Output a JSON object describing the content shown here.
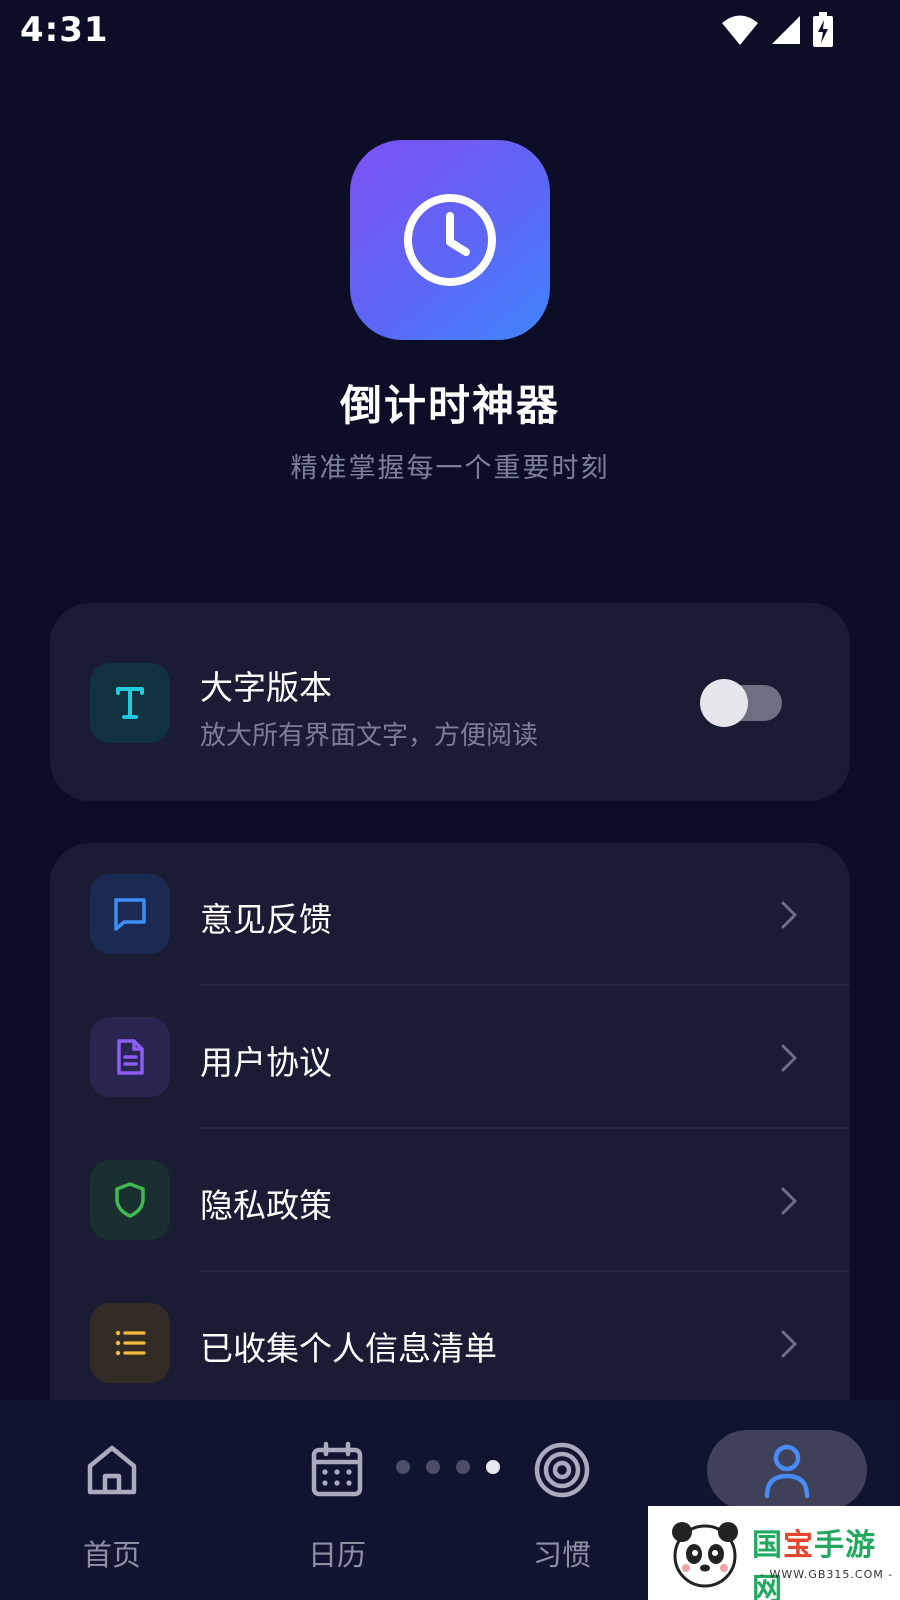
{
  "status_bar": {
    "time": "4:31",
    "icons": [
      "wifi-icon",
      "signal-icon",
      "battery-charging-icon"
    ]
  },
  "header": {
    "app_icon": "clock-icon",
    "app_icon_gradient": [
      "#7d52f4",
      "#3f86fb"
    ],
    "title": "倒计时神器",
    "subtitle": "精准掌握每一个重要时刻"
  },
  "large_text_setting": {
    "icon": "text-t-icon",
    "icon_color": "#22c9e0",
    "title": "大字版本",
    "description": "放大所有界面文字，方便阅读",
    "enabled": false
  },
  "menu": {
    "items": [
      {
        "label": "意见反馈",
        "icon": "message-icon",
        "icon_color": "#3f8ef5"
      },
      {
        "label": "用户协议",
        "icon": "document-icon",
        "icon_color": "#8b5cf6"
      },
      {
        "label": "隐私政策",
        "icon": "shield-icon",
        "icon_color": "#3fb950"
      },
      {
        "label": "已收集个人信息清单",
        "icon": "list-icon",
        "icon_color": "#f5b83d"
      }
    ]
  },
  "bottom_nav": {
    "items": [
      {
        "label": "首页",
        "icon": "home-icon"
      },
      {
        "label": "日历",
        "icon": "calendar-icon"
      },
      {
        "label": "习惯",
        "icon": "target-icon"
      },
      {
        "label": "",
        "icon": "user-icon",
        "active": true
      }
    ],
    "page_indicator": {
      "count": 4,
      "active_index": 3
    }
  },
  "watermark": {
    "title_green": "国",
    "title_red": "宝",
    "title_rest": "手游网",
    "url": "- WWW.GB315.COM -"
  },
  "colors": {
    "background": "#0b0e26",
    "card": "#1a1c33",
    "accent_blue": "#4a8af5"
  }
}
